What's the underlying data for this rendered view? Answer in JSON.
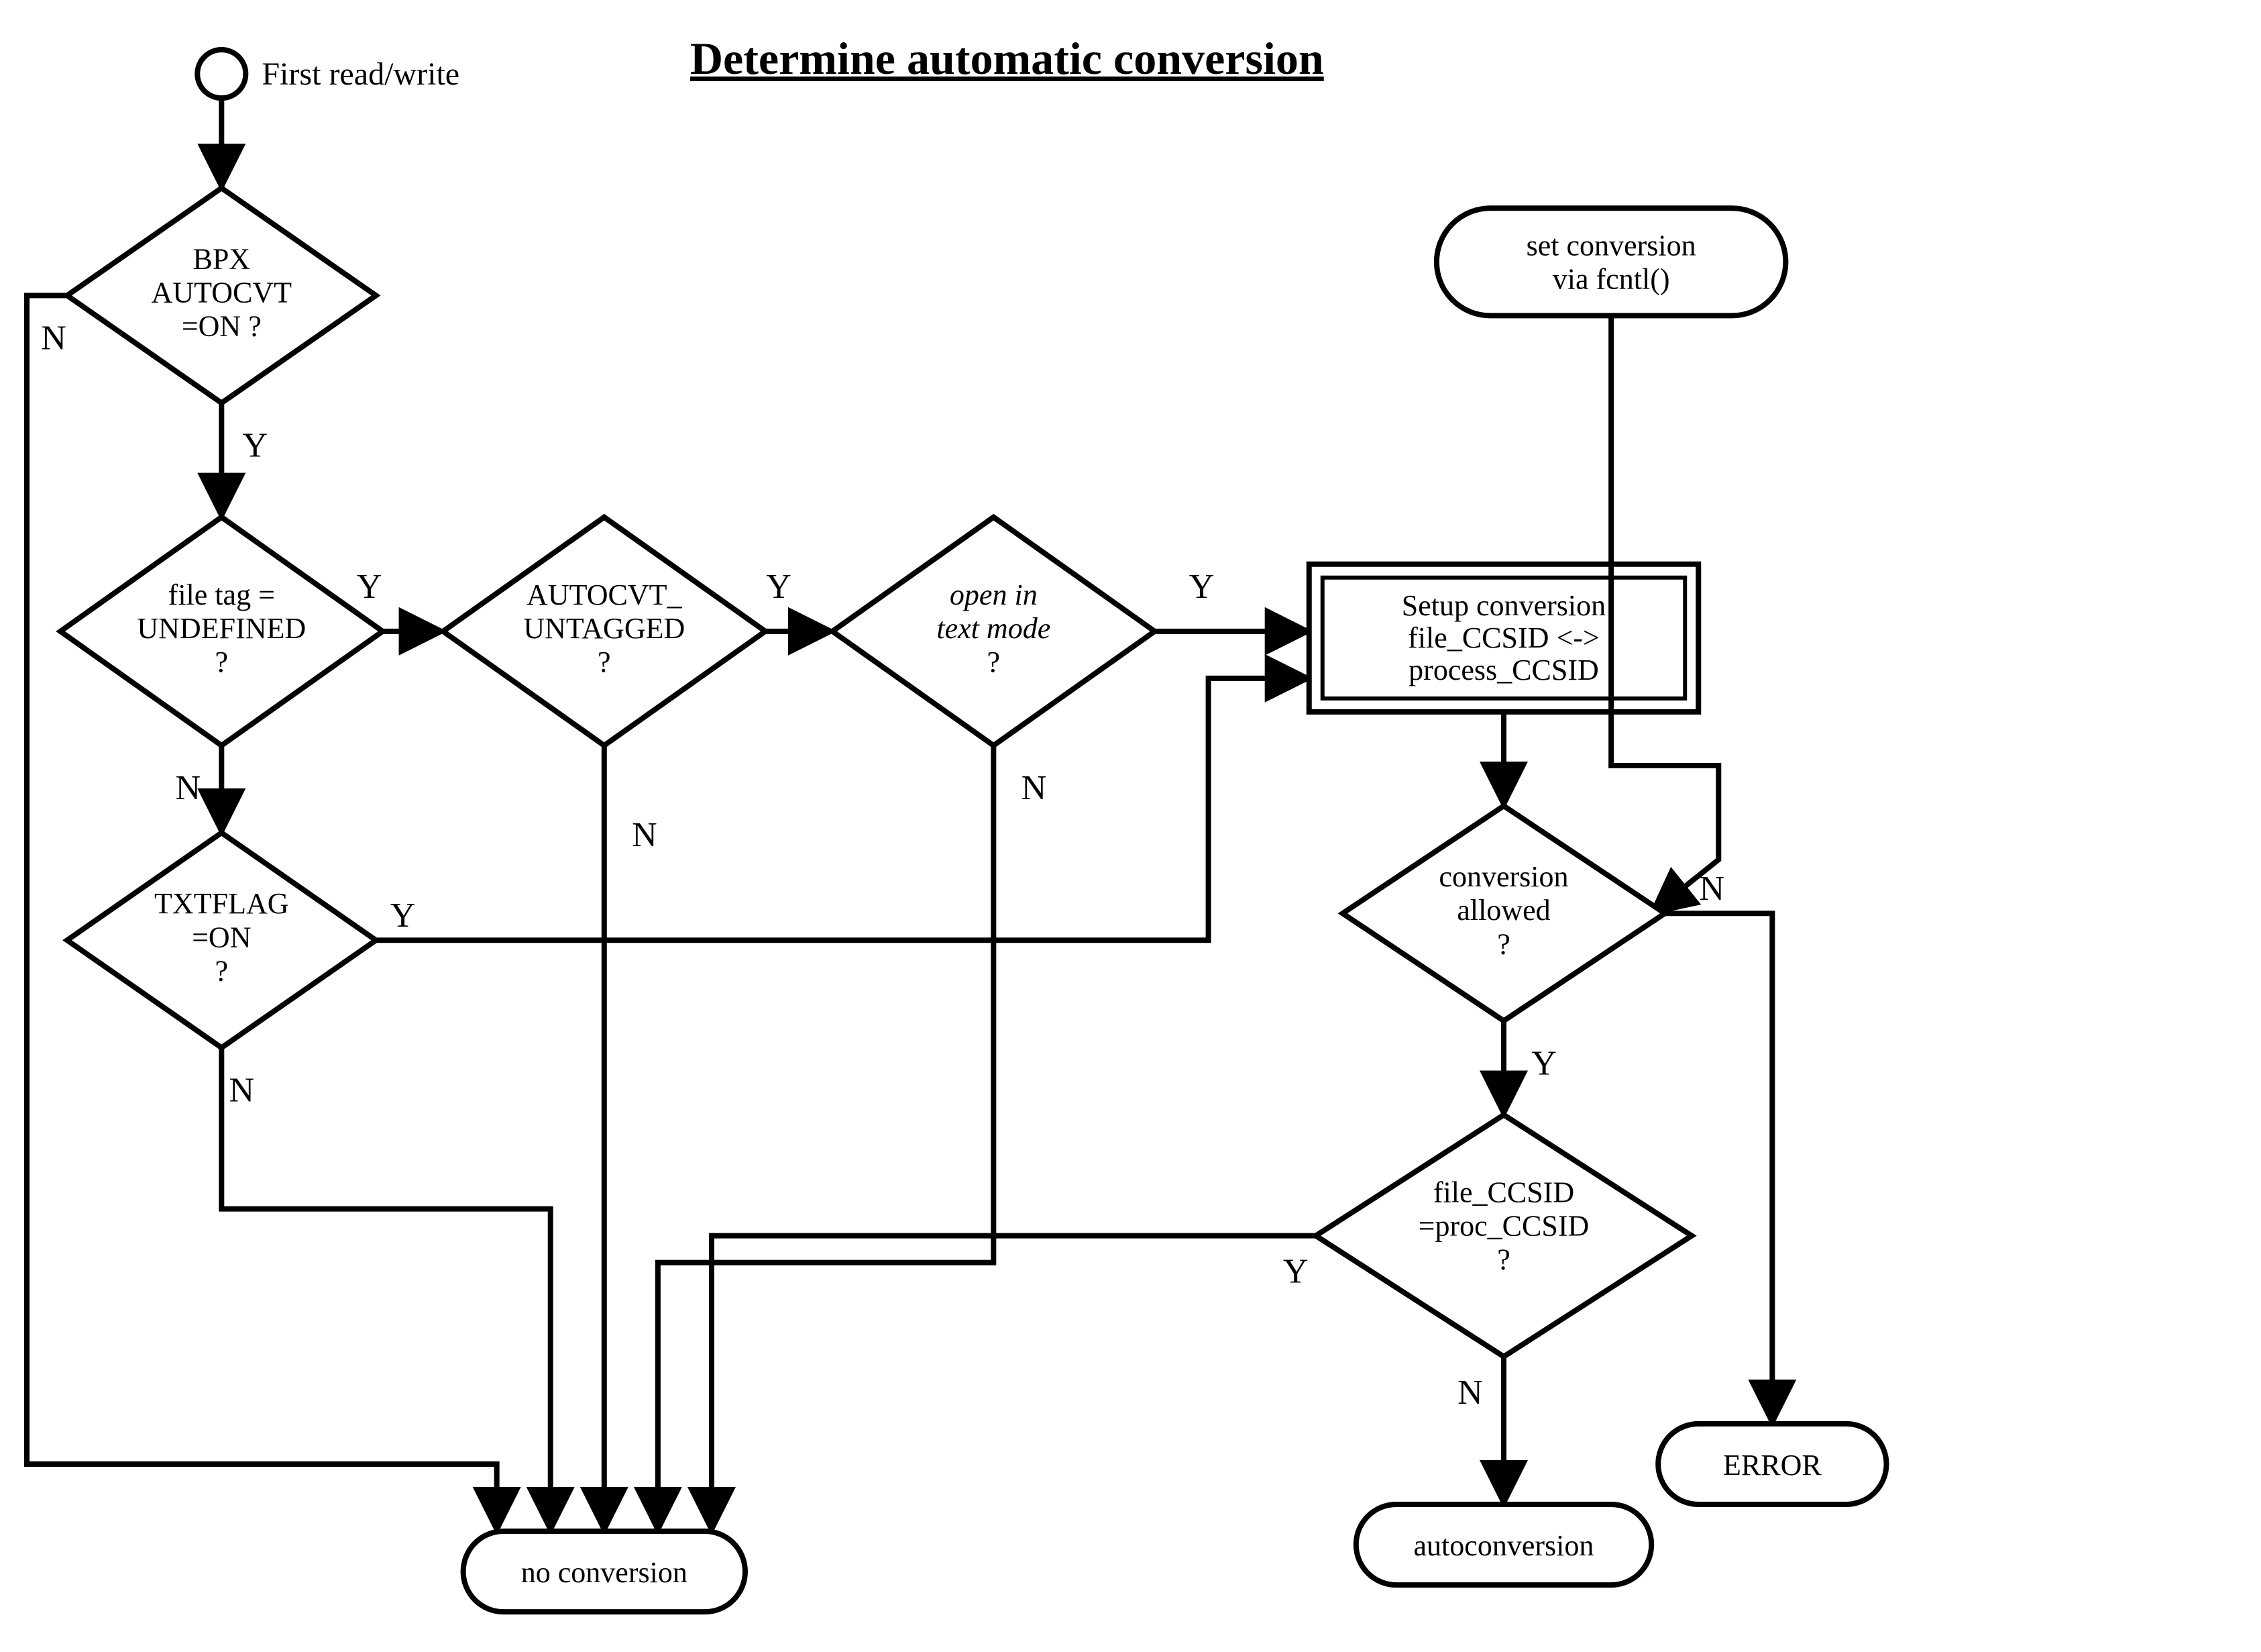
{
  "title": "Determine automatic conversion",
  "start_label": "First read/write",
  "nodes": {
    "bpx": {
      "l1": "BPX",
      "l2": "AUTOCVT",
      "l3": "=ON ?"
    },
    "filetag": {
      "l1": "file tag =",
      "l2": "UNDEFINED",
      "l3": "?"
    },
    "autocvt": {
      "l1": "AUTOCVT_",
      "l2": "UNTAGGED",
      "l3": "?"
    },
    "openin": {
      "l1": "open in",
      "l2": "text mode",
      "l3": "?"
    },
    "txtflag": {
      "l1": "TXTFLAG",
      "l2": "=ON",
      "l3": "?"
    },
    "convallowed": {
      "l1": "conversion",
      "l2": "allowed",
      "l3": "?"
    },
    "ccsidcmp": {
      "l1": "file_CCSID",
      "l2": "=proc_CCSID",
      "l3": "?"
    },
    "setup": {
      "l1": "Setup conversion",
      "l2": "file_CCSID <->",
      "l3": "process_CCSID"
    },
    "fcntl": {
      "l1": "set conversion",
      "l2": "via fcntl()"
    },
    "noconv": {
      "l1": "no conversion"
    },
    "autocv": {
      "l1": "autoconversion"
    },
    "error": {
      "l1": "ERROR"
    }
  },
  "edges": {
    "Y": "Y",
    "N": "N"
  }
}
